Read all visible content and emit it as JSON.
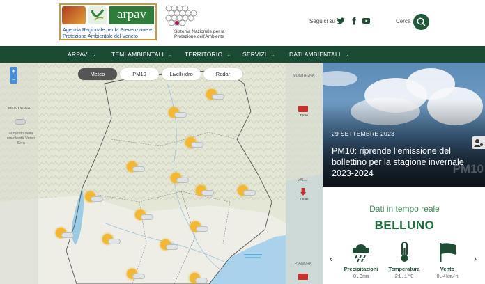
{
  "header": {
    "logo_name": "arpav",
    "logo_desc": "Agenzia Regionale per la Prevenzione e Protezione Ambientale del Veneto",
    "snpa_text": "Sistema Nazionale per la Protezione dell'Ambiente",
    "follow_label": "Seguici su",
    "search_label": "Cerca"
  },
  "nav": {
    "items": [
      {
        "label": "ARPAV"
      },
      {
        "label": "TEMI AMBIENTALI"
      },
      {
        "label": "TERRITORIO"
      },
      {
        "label": "SERVIZI"
      },
      {
        "label": "DATI AMBIENTALI"
      }
    ]
  },
  "map": {
    "zoom_in": "+",
    "zoom_out": "−",
    "pills": [
      {
        "label": "Meteo",
        "active": true
      },
      {
        "label": "PM10",
        "active": false
      },
      {
        "label": "Livelli idro",
        "active": false
      },
      {
        "label": "Radar",
        "active": false
      }
    ],
    "labels": {
      "montagna_left": "MONTAGNA",
      "montagna_right": "MONTAGNA",
      "valli": "VALLI",
      "pianura": "PIANURA",
      "note_left": "aumento della nuvolosità Verso Sera"
    },
    "side_box_label": "T max"
  },
  "hero": {
    "date": "29 SETTEMBRE 2023",
    "title": "PM10: riprende l’emissione del bollettino per la stagione invernale 2023-2024",
    "watermark": "PM10"
  },
  "realtime": {
    "title": "Dati in tempo reale",
    "station": "BELLUNO",
    "prev": "‹",
    "next": "›",
    "items": [
      {
        "label": "Precipitazioni",
        "value": "0.0mm"
      },
      {
        "label": "Temperatura",
        "value": "21.1°C"
      },
      {
        "label": "Vento",
        "value": "0.4km/h"
      }
    ]
  },
  "colors": {
    "brand_green": "#1c4b34",
    "accent_green": "#3f8a5b",
    "sun": "#f4b731"
  }
}
